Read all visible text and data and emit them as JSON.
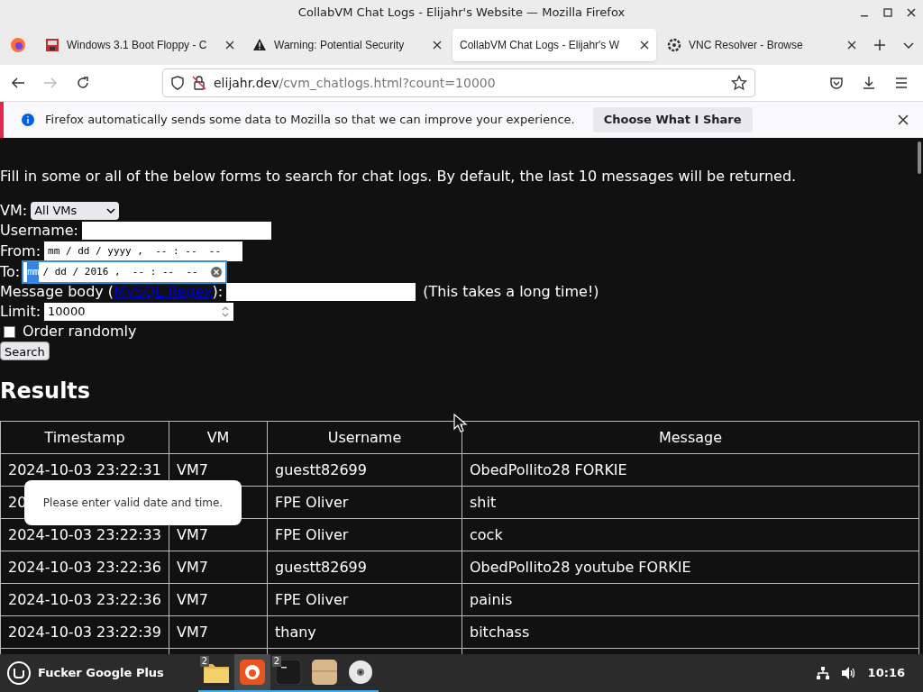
{
  "window": {
    "title": "CollabVM Chat Logs - Elijahr's Website — Mozilla Firefox"
  },
  "tabs": [
    {
      "label": "Windows 3.1 Boot Floppy - C",
      "kind": "dos",
      "selected": false
    },
    {
      "label": "Warning: Potential Security",
      "kind": "warning",
      "selected": false
    },
    {
      "label": "CollabVM Chat Logs - Elijahr's W",
      "kind": "plain",
      "selected": true
    },
    {
      "label": "VNC Resolver - Browse",
      "kind": "vnc",
      "selected": false
    }
  ],
  "address": {
    "domain": "elijahr.dev",
    "path": "/cvm_chatlogs.html?count=10000"
  },
  "notification": {
    "text": "Firefox automatically sends some data to Mozilla so that we can improve your experience.",
    "button": "Choose What I Share"
  },
  "page": {
    "intro": "Fill in some or all of the below forms to search for chat logs. By default, the last 10 messages will be returned.",
    "vm": {
      "label": "VM:",
      "value": "All VMs"
    },
    "username": {
      "label": "Username:"
    },
    "from": {
      "label": "From:",
      "value": "mm / dd / yyyy ,  -- : --  --"
    },
    "to": {
      "label": "To:",
      "highlight": "mm",
      "value": "/ dd / 2016 ,  -- : --  --",
      "focused": true
    },
    "message": {
      "label_before": "Message body (",
      "link": "MySQL Regex",
      "label_after": "):",
      "note": "(This takes a long time!)"
    },
    "limit": {
      "label": "Limit:",
      "value": "10000"
    },
    "random": {
      "label": "Order randomly",
      "checked": false
    },
    "search_button": "Search",
    "results_heading": "Results"
  },
  "table": {
    "columns": [
      "Timestamp",
      "VM",
      "Username",
      "Message"
    ],
    "rows": [
      {
        "timestamp": "2024-10-03 23:22:31",
        "vm": "VM7",
        "username": "guestt82699",
        "message": "ObedPollito28 FORKIE"
      },
      {
        "timestamp": "20",
        "username": "FPE Oliver",
        "message": "shit"
      },
      {
        "timestamp": "2024-10-03 23:22:33",
        "vm": "VM7",
        "username": "FPE Oliver",
        "message": "cock"
      },
      {
        "timestamp": "2024-10-03 23:22:36",
        "vm": "VM7",
        "username": "guestt82699",
        "message": "ObedPollito28 youtube FORKIE"
      },
      {
        "timestamp": "2024-10-03 23:22:36",
        "vm": "VM7",
        "username": "FPE Oliver",
        "message": "painis"
      },
      {
        "timestamp": "2024-10-03 23:22:39",
        "vm": "VM7",
        "username": "thany",
        "message": "bitchass"
      }
    ]
  },
  "tooltip": "Please enter valid date and time.",
  "taskbar": {
    "menu_label": "Fucker Google Plus",
    "apps": [
      {
        "kind": "folder",
        "badge": "2",
        "active": false
      },
      {
        "kind": "firefox",
        "active": true
      },
      {
        "kind": "terminal",
        "badge": "2",
        "active": false
      },
      {
        "kind": "archive",
        "active": false
      },
      {
        "kind": "disc",
        "active": false
      }
    ],
    "clock": "10:16"
  }
}
